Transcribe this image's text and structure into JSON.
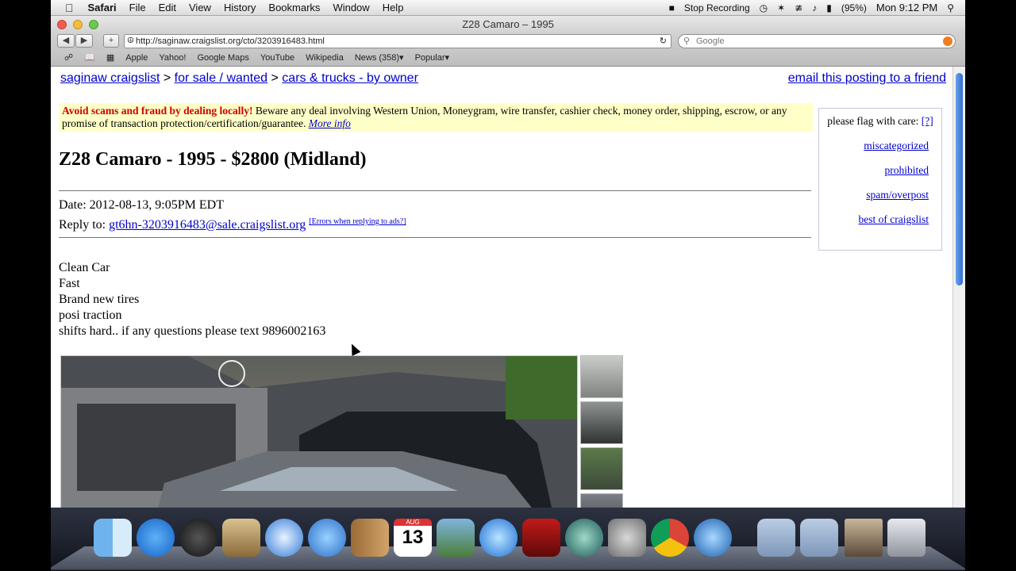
{
  "menubar": {
    "apple": "",
    "app": "Safari",
    "items": [
      "File",
      "Edit",
      "View",
      "History",
      "Bookmarks",
      "Window",
      "Help"
    ],
    "status": {
      "recording": "Stop Recording",
      "battery": "(95%)",
      "clock": "Mon 9:12 PM"
    }
  },
  "window": {
    "title": "Z28 Camaro – 1995"
  },
  "toolbar": {
    "url": "http://saginaw.craigslist.org/cto/3203916483.html",
    "search_placeholder": "Google"
  },
  "bookmarks": [
    "Apple",
    "Yahoo!",
    "Google Maps",
    "YouTube",
    "Wikipedia",
    "News (358)▾",
    "Popular▾"
  ],
  "page": {
    "crumbs": {
      "site": "saginaw craigslist",
      "sep": ">",
      "cat": "for sale / wanted",
      "sub": "cars & trucks - by owner"
    },
    "email_friend": "email this posting to a friend",
    "scam": {
      "warning": "Avoid scams and fraud by dealing locally!",
      "text": " Beware any deal involving Western Union, Moneygram, wire transfer, cashier check, money order, shipping, escrow, or any promise of transaction protection/certification/guarantee. ",
      "more": "More info"
    },
    "flag": {
      "label": "please flag with care:",
      "help": "[?]",
      "links": [
        "miscategorized",
        "prohibited",
        "spam/overpost",
        "best of craigslist"
      ]
    },
    "title": "Z28 Camaro - 1995 - $2800 (Midland)",
    "date": "Date: 2012-08-13, 9:05PM EDT",
    "reply_label": "Reply to:",
    "reply_email": "gt6hn-3203916483@sale.craigslist.org",
    "reply_errors": "[Errors when replying to ads?]",
    "body_lines": [
      "Clean Car",
      "Fast",
      "Brand new tires",
      "posi traction",
      "shifts hard.. if any questions please text 9896002163"
    ]
  },
  "dock": {
    "calendar_month": "AUG",
    "calendar_day": "13"
  }
}
